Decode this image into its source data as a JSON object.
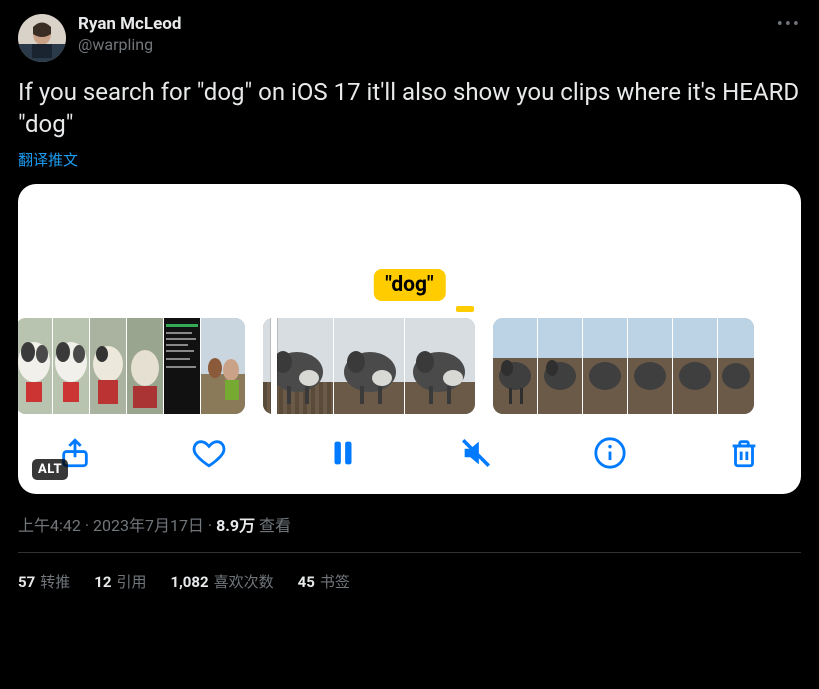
{
  "author": {
    "display_name": "Ryan McLeod",
    "handle": "@warpling"
  },
  "tweet_text": "If you search for \"dog\" on iOS 17 it'll also show you clips where it's HEARD \"dog\"",
  "translate_label": "翻译推文",
  "media": {
    "caption_text": "\"dog\"",
    "alt_badge": "ALT",
    "toolbar": {
      "share": "share",
      "like": "like",
      "pause": "pause",
      "mute": "mute",
      "info": "info",
      "trash": "trash"
    }
  },
  "meta": {
    "time": "上午4:42",
    "sep1": " · ",
    "date": "2023年7月17日",
    "sep2": " · ",
    "views_count": "8.9万",
    "views_label": " 查看"
  },
  "stats": {
    "retweets_count": "57",
    "retweets_label": "转推",
    "quotes_count": "12",
    "quotes_label": "引用",
    "likes_count": "1,082",
    "likes_label": "喜欢次数",
    "bookmarks_count": "45",
    "bookmarks_label": "书签"
  }
}
